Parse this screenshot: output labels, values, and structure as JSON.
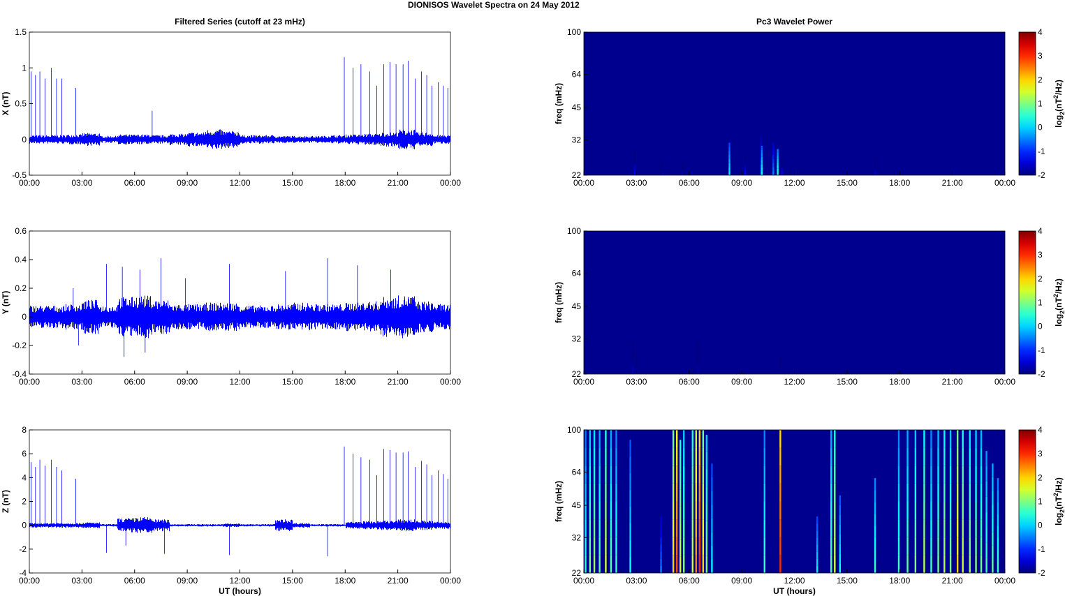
{
  "figure_title": "DIONISOS Wavelet Spectra on 24 May       2012",
  "colors": {
    "series": "#0000ff",
    "background": "#00008f"
  },
  "chart_data": [
    {
      "type": "line",
      "title": "Filtered Series (cutoff at 23 mHz)",
      "ylabel": "X (nT)",
      "xlabel": "",
      "ylim": [
        -0.5,
        1.5
      ],
      "yticks": [
        "-0.5",
        "0",
        "0.5",
        "1",
        "1.5"
      ],
      "xticks": [
        "00:00",
        "03:00",
        "06:00",
        "09:00",
        "12:00",
        "15:00",
        "18:00",
        "21:00",
        "00:00"
      ],
      "noise_amplitude_by_hour": [
        0.06,
        0.06,
        0.07,
        0.09,
        0.05,
        0.07,
        0.07,
        0.06,
        0.08,
        0.1,
        0.14,
        0.12,
        0.06,
        0.06,
        0.05,
        0.05,
        0.05,
        0.06,
        0.07,
        0.08,
        0.1,
        0.14,
        0.1,
        0.06
      ],
      "spikes": [
        [
          0.1,
          0.95
        ],
        [
          0.35,
          0.9
        ],
        [
          0.6,
          0.95
        ],
        [
          0.9,
          0.85
        ],
        [
          1.25,
          1.0
        ],
        [
          1.55,
          0.85
        ],
        [
          1.85,
          0.85
        ],
        [
          2.65,
          0.72
        ],
        [
          7.0,
          0.4
        ],
        [
          17.95,
          1.15
        ],
        [
          18.45,
          1.0
        ],
        [
          18.9,
          1.05
        ],
        [
          19.4,
          0.95
        ],
        [
          19.8,
          0.75
        ],
        [
          20.2,
          1.05
        ],
        [
          20.55,
          1.08
        ],
        [
          20.9,
          1.05
        ],
        [
          21.3,
          1.05
        ],
        [
          21.6,
          1.1
        ],
        [
          22.0,
          0.85
        ],
        [
          22.35,
          0.95
        ],
        [
          22.65,
          0.9
        ],
        [
          22.95,
          0.75
        ],
        [
          23.3,
          0.8
        ],
        [
          23.6,
          0.75
        ],
        [
          23.85,
          0.72
        ]
      ]
    },
    {
      "type": "line",
      "title": "",
      "ylabel": "Y (nT)",
      "xlabel": "",
      "ylim": [
        -0.4,
        0.6
      ],
      "yticks": [
        "-0.4",
        "-0.2",
        "0",
        "0.2",
        "0.4",
        "0.6"
      ],
      "xticks": [
        "00:00",
        "03:00",
        "06:00",
        "09:00",
        "12:00",
        "15:00",
        "18:00",
        "21:00",
        "00:00"
      ],
      "noise_amplitude_by_hour": [
        0.08,
        0.08,
        0.09,
        0.12,
        0.08,
        0.14,
        0.15,
        0.12,
        0.09,
        0.09,
        0.1,
        0.1,
        0.08,
        0.08,
        0.09,
        0.1,
        0.09,
        0.09,
        0.1,
        0.11,
        0.14,
        0.15,
        0.11,
        0.09
      ],
      "spikes": [
        [
          2.5,
          0.2
        ],
        [
          4.4,
          0.37
        ],
        [
          5.3,
          0.35
        ],
        [
          6.3,
          0.33
        ],
        [
          7.5,
          0.41
        ],
        [
          8.9,
          0.27
        ],
        [
          11.4,
          0.37
        ],
        [
          14.6,
          0.32
        ],
        [
          17.0,
          0.41
        ],
        [
          18.7,
          0.36
        ],
        [
          20.6,
          0.33
        ],
        [
          5.4,
          -0.28
        ],
        [
          6.6,
          -0.25
        ],
        [
          2.8,
          -0.2
        ]
      ]
    },
    {
      "type": "line",
      "title": "",
      "ylabel": "Z (nT)",
      "xlabel": "UT (hours)",
      "ylim": [
        -4,
        8
      ],
      "yticks": [
        "-4",
        "-2",
        "0",
        "2",
        "4",
        "6",
        "8"
      ],
      "xticks": [
        "00:00",
        "03:00",
        "06:00",
        "09:00",
        "12:00",
        "15:00",
        "18:00",
        "21:00",
        "00:00"
      ],
      "noise_amplitude_by_hour": [
        0.2,
        0.2,
        0.2,
        0.25,
        0.1,
        0.6,
        0.7,
        0.5,
        0.1,
        0.1,
        0.1,
        0.15,
        0.1,
        0.1,
        0.5,
        0.2,
        0.1,
        0.1,
        0.3,
        0.35,
        0.4,
        0.5,
        0.4,
        0.3
      ],
      "spikes": [
        [
          0.1,
          5.3
        ],
        [
          0.35,
          4.9
        ],
        [
          0.6,
          5.5
        ],
        [
          0.9,
          5.0
        ],
        [
          1.25,
          5.5
        ],
        [
          1.55,
          4.9
        ],
        [
          1.85,
          4.6
        ],
        [
          2.65,
          3.9
        ],
        [
          5.5,
          -1.7
        ],
        [
          7.7,
          -2.4
        ],
        [
          11.4,
          -2.5
        ],
        [
          17.0,
          -2.6
        ],
        [
          4.4,
          -2.3
        ],
        [
          17.95,
          6.6
        ],
        [
          18.45,
          6.0
        ],
        [
          18.9,
          5.7
        ],
        [
          19.4,
          5.5
        ],
        [
          19.8,
          4.2
        ],
        [
          20.2,
          6.4
        ],
        [
          20.55,
          6.3
        ],
        [
          20.9,
          6.1
        ],
        [
          21.3,
          6.1
        ],
        [
          21.6,
          6.2
        ],
        [
          22.0,
          4.9
        ],
        [
          22.35,
          5.4
        ],
        [
          22.65,
          5.1
        ],
        [
          22.95,
          4.2
        ],
        [
          23.3,
          4.6
        ],
        [
          23.6,
          4.3
        ],
        [
          23.85,
          3.9
        ]
      ]
    },
    {
      "type": "heatmap",
      "title": "Pc3 Wavelet Power",
      "ylabel": "freq (mHz)",
      "xlabel": "",
      "ylim": [
        22,
        100
      ],
      "yticks": [
        "22",
        "32",
        "45",
        "64",
        "100"
      ],
      "xticks": [
        "00:00",
        "03:00",
        "06:00",
        "09:00",
        "12:00",
        "15:00",
        "18:00",
        "21:00",
        "00:00"
      ],
      "colorbar": {
        "label": "log2(nT2/Hz)",
        "range": [
          -2,
          4
        ],
        "ticks": [
          "-2",
          "-1",
          "0",
          "1",
          "2",
          "3",
          "4"
        ]
      },
      "events": [
        [
          2.9,
          28,
          -1.3
        ],
        [
          4.5,
          25,
          -1.6
        ],
        [
          5.6,
          25,
          -1.6
        ],
        [
          8.3,
          31,
          0.2
        ],
        [
          9.2,
          27,
          -1.2
        ],
        [
          10.1,
          35,
          -0.8
        ],
        [
          10.15,
          30,
          0.3
        ],
        [
          10.8,
          31,
          -0.5
        ],
        [
          11.05,
          29,
          0.5
        ],
        [
          11.3,
          26,
          -1.3
        ],
        [
          16.6,
          26,
          -1.5
        ]
      ]
    },
    {
      "type": "heatmap",
      "title": "",
      "ylabel": "freq (mHz)",
      "xlabel": "",
      "ylim": [
        22,
        100
      ],
      "yticks": [
        "22",
        "32",
        "45",
        "64",
        "100"
      ],
      "xticks": [
        "00:00",
        "03:00",
        "06:00",
        "09:00",
        "12:00",
        "15:00",
        "18:00",
        "21:00",
        "00:00"
      ],
      "colorbar": {
        "label": "log2(nT2/Hz)",
        "range": [
          -2,
          4
        ],
        "ticks": [
          "-2",
          "-1",
          "0",
          "1",
          "2",
          "3",
          "4"
        ]
      },
      "events": [
        [
          2.8,
          31,
          -1.6
        ],
        [
          3.0,
          28,
          -1.7
        ],
        [
          6.5,
          31,
          -1.7
        ],
        [
          11.2,
          26,
          -1.8
        ]
      ]
    },
    {
      "type": "heatmap",
      "title": "",
      "ylabel": "freq (mHz)",
      "xlabel": "UT (hours)",
      "ylim": [
        22,
        100
      ],
      "yticks": [
        "22",
        "32",
        "45",
        "64",
        "100"
      ],
      "xticks": [
        "00:00",
        "03:00",
        "06:00",
        "09:00",
        "12:00",
        "15:00",
        "18:00",
        "21:00",
        "00:00"
      ],
      "colorbar": {
        "label": "log2(nT2/Hz)",
        "range": [
          -2,
          4
        ],
        "ticks": [
          "-2",
          "-1",
          "0",
          "1",
          "2",
          "3",
          "4"
        ]
      },
      "events": [
        [
          0.1,
          100,
          0.5
        ],
        [
          0.35,
          100,
          1.0
        ],
        [
          0.6,
          100,
          1.2
        ],
        [
          0.9,
          100,
          0.8
        ],
        [
          1.25,
          100,
          1.5
        ],
        [
          1.55,
          100,
          0.8
        ],
        [
          1.85,
          100,
          0.6
        ],
        [
          2.65,
          90,
          0.3
        ],
        [
          4.4,
          40,
          -0.5
        ],
        [
          5.1,
          100,
          2.0
        ],
        [
          5.3,
          100,
          2.8
        ],
        [
          5.5,
          90,
          1.5
        ],
        [
          5.7,
          100,
          1.0
        ],
        [
          6.2,
          100,
          1.5
        ],
        [
          6.4,
          100,
          2.5
        ],
        [
          6.6,
          100,
          3.0
        ],
        [
          6.8,
          100,
          2.0
        ],
        [
          7.0,
          95,
          1.0
        ],
        [
          7.3,
          70,
          0.2
        ],
        [
          10.3,
          100,
          0.6
        ],
        [
          11.2,
          100,
          3.0
        ],
        [
          13.3,
          40,
          0.2
        ],
        [
          14.1,
          100,
          0.8
        ],
        [
          14.3,
          100,
          1.5
        ],
        [
          14.6,
          50,
          0.3
        ],
        [
          16.6,
          60,
          0.6
        ],
        [
          17.95,
          100,
          0.6
        ],
        [
          18.45,
          100,
          0.8
        ],
        [
          18.9,
          100,
          1.0
        ],
        [
          19.4,
          100,
          1.3
        ],
        [
          19.8,
          100,
          0.6
        ],
        [
          20.2,
          100,
          0.9
        ],
        [
          20.55,
          100,
          1.3
        ],
        [
          20.9,
          100,
          1.0
        ],
        [
          21.3,
          100,
          2.0
        ],
        [
          21.6,
          100,
          1.5
        ],
        [
          22.0,
          100,
          1.2
        ],
        [
          22.35,
          100,
          1.0
        ],
        [
          22.65,
          100,
          0.9
        ],
        [
          22.95,
          80,
          0.7
        ],
        [
          23.3,
          70,
          0.8
        ],
        [
          23.6,
          60,
          0.6
        ]
      ]
    }
  ]
}
